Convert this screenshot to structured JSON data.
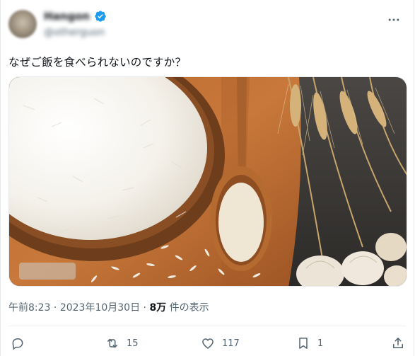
{
  "post": {
    "author_name": "Hangon",
    "author_handle": "@otherguon",
    "text": "なぜご飯を食べられないのですか？",
    "time": "午前8:23",
    "date": "2023年10月30日",
    "views_count": "8万",
    "views_label": "件の表示",
    "sep": "·"
  },
  "actions": {
    "reply_count": "",
    "retweet_count": "15",
    "like_count": "117",
    "bookmark_count": "1"
  },
  "icons": [
    "verified-icon",
    "more-icon",
    "reply-icon",
    "retweet-icon",
    "like-icon",
    "bookmark-icon",
    "share-icon"
  ],
  "colors": {
    "verified": "#1d9bf0",
    "secondary_text": "#536471"
  }
}
